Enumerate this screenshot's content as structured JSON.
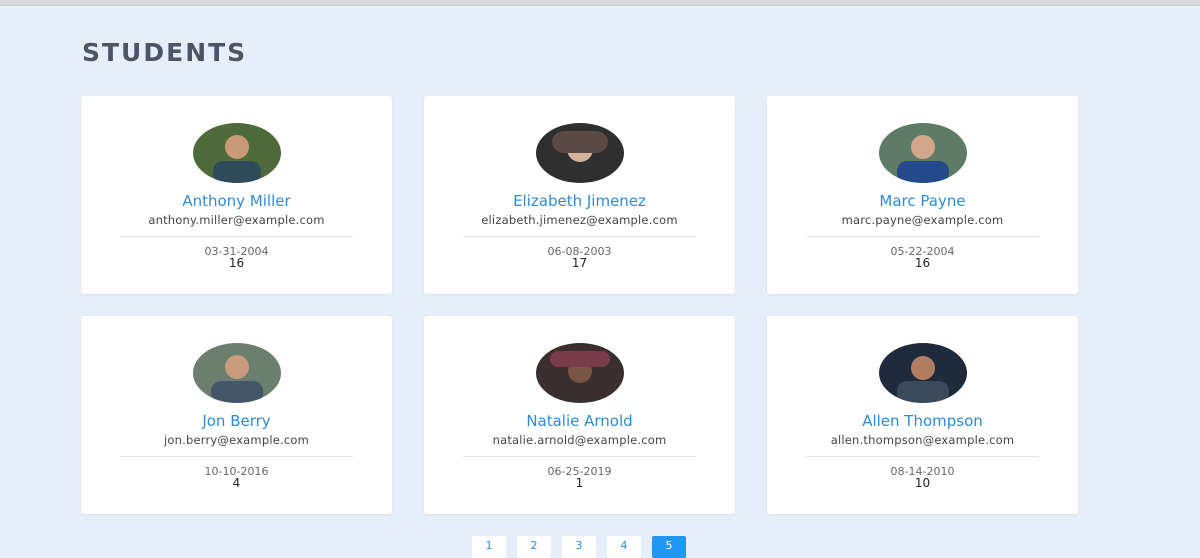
{
  "page": {
    "title": "STUDENTS"
  },
  "students": [
    {
      "name": "Anthony Miller",
      "email": "anthony.miller@example.com",
      "dob": "03-31-2004",
      "age": "16",
      "avatar_icon": "person-photo-avatar",
      "avatar_colors": [
        "#4f6a3a",
        "#2f4a5a",
        "#c89a78"
      ]
    },
    {
      "name": "Elizabeth Jimenez",
      "email": "elizabeth.jimenez@example.com",
      "dob": "06-08-2003",
      "age": "17",
      "avatar_icon": "person-photo-avatar",
      "avatar_colors": [
        "#2f2f2f",
        "#5a4a43",
        "#d3b29b"
      ]
    },
    {
      "name": "Marc Payne",
      "email": "marc.payne@example.com",
      "dob": "05-22-2004",
      "age": "16",
      "avatar_icon": "person-photo-avatar",
      "avatar_colors": [
        "#5d7b65",
        "#244a8a",
        "#d2a68a"
      ]
    },
    {
      "name": "Jon Berry",
      "email": "jon.berry@example.com",
      "dob": "10-10-2016",
      "age": "4",
      "avatar_icon": "person-photo-avatar",
      "avatar_colors": [
        "#6c7f6f",
        "#44566a",
        "#c79b7b"
      ]
    },
    {
      "name": "Natalie Arnold",
      "email": "natalie.arnold@example.com",
      "dob": "06-25-2019",
      "age": "1",
      "avatar_icon": "person-photo-avatar",
      "avatar_colors": [
        "#3a2e2e",
        "#7a3b4a",
        "#7a5544"
      ]
    },
    {
      "name": "Allen Thompson",
      "email": "allen.thompson@example.com",
      "dob": "08-14-2010",
      "age": "10",
      "avatar_icon": "person-photo-avatar",
      "avatar_colors": [
        "#1f2a3a",
        "#3a4a5a",
        "#b07d62"
      ]
    }
  ],
  "pagination": {
    "pages": [
      "1",
      "2",
      "3",
      "4",
      "5"
    ],
    "active": "5"
  }
}
